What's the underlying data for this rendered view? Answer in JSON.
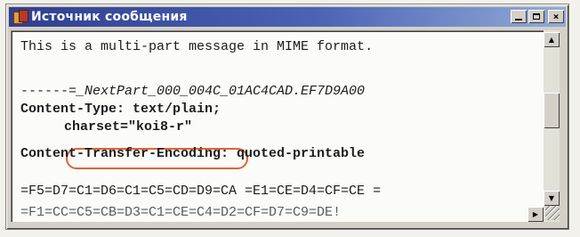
{
  "window": {
    "title": "Источник сообщения",
    "buttons": {
      "minimize": "minimize",
      "maximize": "maximize",
      "close": "×"
    }
  },
  "message": {
    "line1": "This is a multi-part message in MIME format.",
    "line2": "------=_NextPart_000_004C_01AC4CAD.EF7D9A00",
    "line3": "Content-Type: text/plain;",
    "line4": "charset=\"koi8-r\"",
    "line5": "Content-Transfer-Encoding: quoted-printable",
    "line6": "=F5=D7=C1=D6=C1=C5=CD=D9=CA =E1=CE=D4=CF=CE =",
    "line7": "=F1=CC=C5=CB=D3=C1=CE=C4=D2=CF=D7=C9=DE!"
  },
  "highlight_color": "#e0623a",
  "icons": [
    "app-icon",
    "minimize-icon",
    "maximize-icon",
    "close-icon",
    "scroll-up-icon",
    "scroll-down-icon",
    "scroll-right-icon",
    "size-grip-icon"
  ]
}
